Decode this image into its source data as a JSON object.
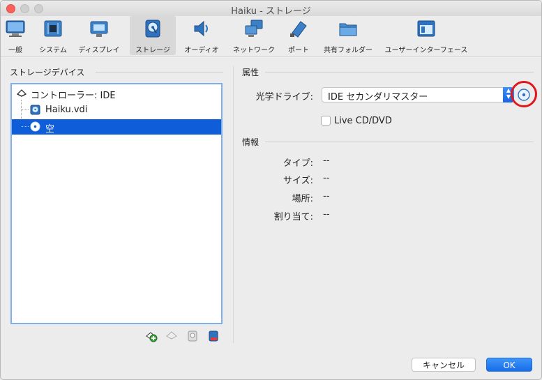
{
  "window": {
    "title": "Haiku - ストレージ"
  },
  "toolbar": {
    "items": [
      {
        "label": "一般"
      },
      {
        "label": "システム"
      },
      {
        "label": "ディスプレイ"
      },
      {
        "label": "ストレージ",
        "selected": true
      },
      {
        "label": "オーディオ"
      },
      {
        "label": "ネットワーク"
      },
      {
        "label": "ポート"
      },
      {
        "label": "共有フォルダー"
      },
      {
        "label": "ユーザーインターフェース"
      }
    ]
  },
  "left": {
    "heading": "ストレージデバイス",
    "tree": {
      "controller": "コントローラー: IDE",
      "disk": "Haiku.vdi",
      "optical": "空"
    }
  },
  "attributes": {
    "heading": "属性",
    "optical_drive_label": "光学ドライブ:",
    "optical_drive_value": "IDE セカンダリマスター",
    "livecd_label": "Live CD/DVD",
    "livecd_checked": false
  },
  "info": {
    "heading": "情報",
    "type_label": "タイプ:",
    "type_value": "--",
    "size_label": "サイズ:",
    "size_value": "--",
    "location_label": "場所:",
    "location_value": "--",
    "attached_label": "割り当て:",
    "attached_value": "--"
  },
  "buttons": {
    "cancel": "キャンセル",
    "ok": "OK"
  },
  "colors": {
    "selection": "#0f5dd8",
    "accent": "#1a6ae0",
    "highlight_circle": "#e0181c"
  }
}
